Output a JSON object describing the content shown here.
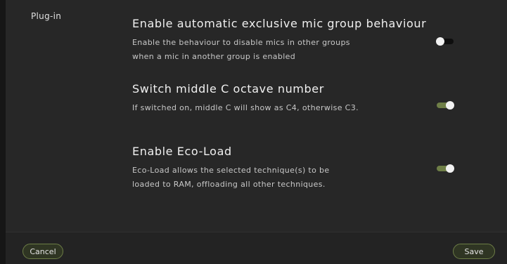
{
  "section": {
    "label": "Plug-in"
  },
  "settings": [
    {
      "title": "Enable automatic exclusive mic group behaviour",
      "desc_lines": [
        "Enable the behaviour to disable mics in other groups",
        "when a mic in another group is enabled"
      ],
      "enabled": false
    },
    {
      "title": "Switch middle C octave number",
      "desc_lines": [
        "If switched on, middle C will show as C4, otherwise C3."
      ],
      "enabled": true
    },
    {
      "title": "Enable Eco-Load",
      "desc_lines": [
        "Eco-Load allows the selected technique(s) to be",
        "loaded to RAM, offloading all other techniques."
      ],
      "enabled": true
    }
  ],
  "footer": {
    "cancel_label": "Cancel",
    "save_label": "Save"
  },
  "colors": {
    "accent": "#6f7f47",
    "background": "#272727"
  }
}
